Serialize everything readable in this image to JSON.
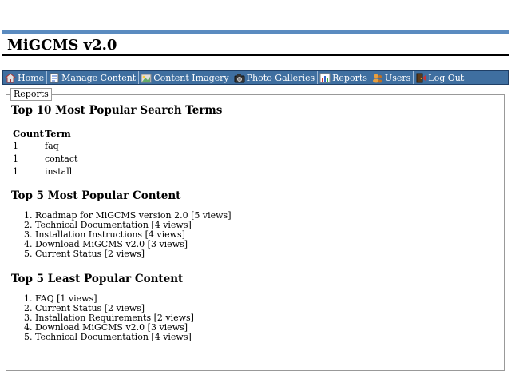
{
  "app": {
    "title": "MiGCMS v2.0"
  },
  "nav": [
    {
      "label": "Home",
      "icon": "home-icon"
    },
    {
      "label": "Manage Content",
      "icon": "document-icon"
    },
    {
      "label": "Content Imagery",
      "icon": "image-icon"
    },
    {
      "label": "Photo Galleries",
      "icon": "camera-icon"
    },
    {
      "label": "Reports",
      "icon": "chart-icon"
    },
    {
      "label": "Users",
      "icon": "users-icon"
    },
    {
      "label": "Log Out",
      "icon": "logout-icon"
    }
  ],
  "panel": {
    "legend": "Reports"
  },
  "search_terms": {
    "heading": "Top 10 Most Popular Search Terms",
    "columns": [
      "Count",
      "Term"
    ],
    "rows": [
      {
        "count": "1",
        "term": "faq"
      },
      {
        "count": "1",
        "term": "contact"
      },
      {
        "count": "1",
        "term": "install"
      }
    ]
  },
  "most_popular": {
    "heading": "Top 5 Most Popular Content",
    "items": [
      "Roadmap for MiGCMS version 2.0 [5 views]",
      "Technical Documentation [4 views]",
      "Installation Instructions [4 views]",
      "Download MiGCMS v2.0 [3 views]",
      "Current Status [2 views]"
    ]
  },
  "least_popular": {
    "heading": "Top 5 Least Popular Content",
    "items": [
      "FAQ [1 views]",
      "Current Status [2 views]",
      "Installation Requirements [2 views]",
      "Download MiGCMS v2.0 [3 views]",
      "Technical Documentation [4 views]"
    ]
  }
}
